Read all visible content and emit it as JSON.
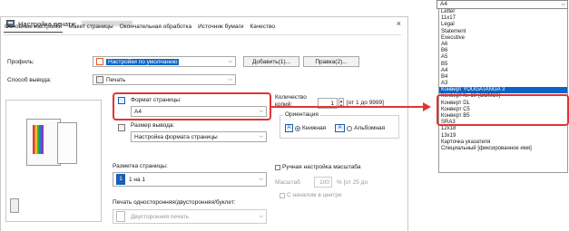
{
  "dialog": {
    "title": "Настройка печати:",
    "close_glyph": "×"
  },
  "tabs": [
    {
      "label": "Основные настройки"
    },
    {
      "label": "Макет страницы"
    },
    {
      "label": "Окончательная обработка"
    },
    {
      "label": "Источник бумаги"
    },
    {
      "label": "Качество"
    }
  ],
  "profile": {
    "label": "Профиль:",
    "value": "Настройки по умолчанию",
    "add_button": "Добавить(1)...",
    "edit_button": "Правка(2)..."
  },
  "output_method": {
    "label": "Способ вывода:",
    "value": "Печать"
  },
  "page_size": {
    "label": "Формат страницы:",
    "value": "A4"
  },
  "output_size": {
    "label": "Размер вывода:",
    "value": "Настройка формата страницы"
  },
  "copies": {
    "label": "Количество",
    "label2": "копий:",
    "value": "1",
    "range": "[от 1 до 9999]"
  },
  "orientation": {
    "label": "Ориентация",
    "portrait": "Книжная",
    "landscape": "Альбомная"
  },
  "layout": {
    "label": "Разметка страницы:",
    "value": "1 на 1",
    "badge": "1"
  },
  "scaling": {
    "manual_label": "Ручная настройка масштаба",
    "scale_label": "Масштаб",
    "scale_value": "100",
    "scale_range": "% [от 25 до",
    "center_label": "С началом в центре"
  },
  "duplex": {
    "label": "Печать односторонняя/двусторонняя/буклет:",
    "value": "Двусторонняя печать"
  },
  "dropdown": {
    "selected": "A4",
    "items": [
      "Letter",
      "11x17",
      "Legal",
      "Statement",
      "Executive",
      "A6",
      "B6",
      "A5",
      "B5",
      "A4",
      "B4",
      "A3",
      "Конверт YOUGATANGA 3",
      "Конверт № 10 (COM10)",
      "Конверт DL",
      "Конверт C5",
      "Конверт B5",
      "SRA3",
      "12x18",
      "13x19",
      "Карточка указателя",
      "Специальный [фиксированное имя]"
    ],
    "highlight_index": 12
  },
  "colors": {
    "accent": "#0a64c8",
    "callout": "#e23333"
  }
}
